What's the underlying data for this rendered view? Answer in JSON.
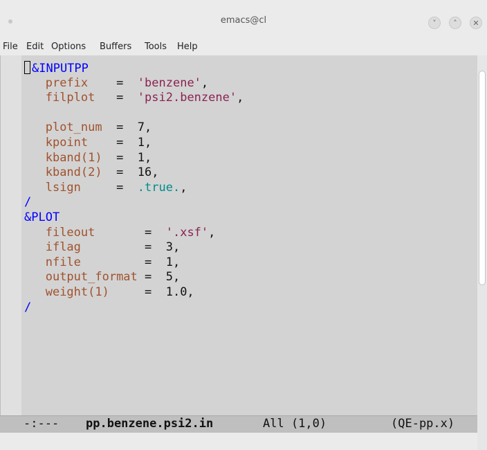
{
  "window": {
    "title": "emacs@cl",
    "controls": [
      {
        "name": "minimize",
        "icon": "chevron-down-icon",
        "glyph": "˅"
      },
      {
        "name": "maximize",
        "icon": "chevron-up-icon",
        "glyph": "˄"
      },
      {
        "name": "close",
        "icon": "close-icon",
        "glyph": "✕"
      }
    ]
  },
  "menu": [
    "File",
    "Edit",
    "Options",
    "Buffers",
    "Tools",
    "Help"
  ],
  "editor": {
    "lines": [
      [
        {
          "t": "&INPUTPP",
          "c": "kw"
        }
      ],
      [
        {
          "t": "   "
        },
        {
          "t": "prefix",
          "c": "var"
        },
        {
          "t": "    =  "
        },
        {
          "t": "'benzene'",
          "c": "str"
        },
        {
          "t": ","
        }
      ],
      [
        {
          "t": "   "
        },
        {
          "t": "filplot",
          "c": "var"
        },
        {
          "t": "   =  "
        },
        {
          "t": "'psi2.benzene'",
          "c": "str"
        },
        {
          "t": ","
        }
      ],
      [],
      [
        {
          "t": "   "
        },
        {
          "t": "plot_num",
          "c": "var"
        },
        {
          "t": "  =  7,"
        }
      ],
      [
        {
          "t": "   "
        },
        {
          "t": "kpoint",
          "c": "var"
        },
        {
          "t": "    =  1,"
        }
      ],
      [
        {
          "t": "   "
        },
        {
          "t": "kband(1)",
          "c": "var"
        },
        {
          "t": "  =  1,"
        }
      ],
      [
        {
          "t": "   "
        },
        {
          "t": "kband(2)",
          "c": "var"
        },
        {
          "t": "  =  16,"
        }
      ],
      [
        {
          "t": "   "
        },
        {
          "t": "lsign",
          "c": "var"
        },
        {
          "t": "     =  "
        },
        {
          "t": ".true.",
          "c": "con"
        },
        {
          "t": ","
        }
      ],
      [
        {
          "t": "/",
          "c": "kw"
        }
      ],
      [
        {
          "t": "&PLOT",
          "c": "kw"
        }
      ],
      [
        {
          "t": "   "
        },
        {
          "t": "fileout",
          "c": "var"
        },
        {
          "t": "       =  "
        },
        {
          "t": "'.xsf'",
          "c": "str"
        },
        {
          "t": ","
        }
      ],
      [
        {
          "t": "   "
        },
        {
          "t": "iflag",
          "c": "var"
        },
        {
          "t": "         =  3,"
        }
      ],
      [
        {
          "t": "   "
        },
        {
          "t": "nfile",
          "c": "var"
        },
        {
          "t": "         =  1,"
        }
      ],
      [
        {
          "t": "   "
        },
        {
          "t": "output_format",
          "c": "var"
        },
        {
          "t": " =  5,"
        }
      ],
      [
        {
          "t": "   "
        },
        {
          "t": "weight(1)",
          "c": "var"
        },
        {
          "t": "     =  1.0,"
        }
      ],
      [
        {
          "t": "/",
          "c": "kw"
        }
      ]
    ]
  },
  "modeline": {
    "status": "-:---",
    "buffer": "pp.benzene.psi2.in",
    "position": "All (1,0)",
    "mode": "(QE-pp.x)"
  },
  "colors": {
    "keyword": "#0000ff",
    "variable": "#a0522d",
    "string": "#8b2252",
    "constant": "#008b8b",
    "background": "#d3d3d3"
  }
}
